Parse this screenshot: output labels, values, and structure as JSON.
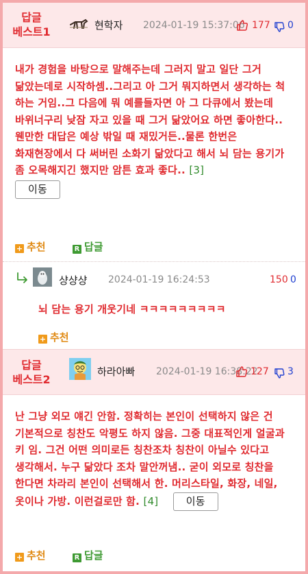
{
  "best1": {
    "tag_line1": "답글",
    "tag_line2": "베스트1",
    "nickname": "현학자",
    "date": "2024-01-19 15:37:06",
    "up_count": "177",
    "down_count": "0",
    "body": "내가 경험을 바탕으로 말해주는데 그러지 말고 일단 그거 닮았는데로 시작하셈..그리고 아 그거 뭐지하면서 생각하는 척 하는 거임..그 다음에 뭐 예를들자면 아 그 다큐에서 봤는데 바위너구리 낮잠 자고 있을 때 그거 닮았어요 하면 좋아한다..웬만한 대답은 예상 밖일 때 재밌거든..물론 한번은 화재현장에서 다 써버린 소화기 닮았다고 해서 뇌 담는 용기가 좀 오목해지긴 했지만 암튼 효과 좋다..",
    "ref": "[3]",
    "move_label": "이동",
    "recommend_label": "추천",
    "reply_label": "답글"
  },
  "reply": {
    "nickname": "샹샹샹",
    "date": "2024-01-19 16:24:53",
    "up_count": "150",
    "down_count": "0",
    "body": "뇌 담는 용기 개웃기네 ㅋㅋㅋㅋㅋㅋㅋㅋㅋ",
    "recommend_label": "추천"
  },
  "best2": {
    "tag_line1": "답글",
    "tag_line2": "베스트2",
    "nickname": "하라아빠",
    "date": "2024-01-19 16:38:22",
    "up_count": "127",
    "down_count": "3",
    "body": "난 그냥 외모 얘긴 안함. 정확히는 본인이 선택하지 않은 건 기본적으로 칭찬도 악평도 하지 않음. 그중 대표적인게 얼굴과 키 임. 그건 어떤 의미로든 칭찬조차 칭찬이 아닐수 있다고 생각해서. 누구 닮았다 조차 말안꺼냄.. 굳이 외모로 칭찬을 한다면 차라리 본인이 선택해서 한. 머리스타일, 화장, 네일, 옷이나 가방. 이런걸로만 함.",
    "ref": "[4]",
    "move_label": "이동",
    "recommend_label": "추천",
    "reply_label": "답글"
  },
  "colors": {
    "accent_red": "#e02a2f",
    "border_pink": "#f4a9ab",
    "header_bg": "#fde8e9",
    "down_blue": "#1f3fd0",
    "ref_green": "#2f8a2a"
  }
}
